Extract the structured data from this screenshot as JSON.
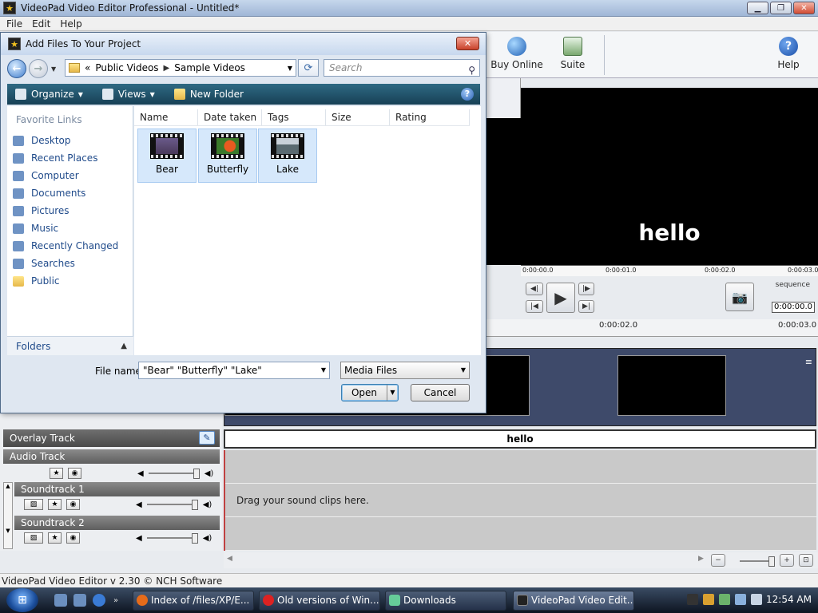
{
  "app": {
    "title": "VideoPad Video Editor Professional - Untitled*",
    "menu": [
      "File",
      "Edit",
      "Help"
    ],
    "toolbar": {
      "buy_online": "Buy Online",
      "suite": "Suite",
      "help": "Help"
    },
    "preview": {
      "text": "hello",
      "ruler": [
        "0:00:00.0",
        "0:00:01.0",
        "0:00:02.0",
        "0:00:03.0"
      ],
      "sequence_label": "sequence",
      "time": "0:00:00.0"
    },
    "timeline": {
      "ruler": [
        "0:00:02.0",
        "0:00:03.0"
      ],
      "overlay_text": "hello",
      "drag_hint": "Drag your sound clips here."
    },
    "tracks": {
      "overlay": "Overlay Track",
      "audio": "Audio Track",
      "soundtrack1": "Soundtrack 1",
      "soundtrack2": "Soundtrack 2"
    },
    "status": "VideoPad Video Editor v 2.30 © NCH Software"
  },
  "dialog": {
    "title": "Add Files To Your Project",
    "address": {
      "chevron": "«",
      "crumbs": [
        "Public Videos",
        "Sample Videos"
      ]
    },
    "search_placeholder": "Search",
    "commands": {
      "organize": "Organize",
      "views": "Views",
      "new_folder": "New Folder"
    },
    "favorites_header": "Favorite Links",
    "favorites": [
      "Desktop",
      "Recent Places",
      "Computer",
      "Documents",
      "Pictures",
      "Music",
      "Recently Changed",
      "Searches",
      "Public"
    ],
    "folders_label": "Folders",
    "columns": [
      "Name",
      "Date taken",
      "Tags",
      "Size",
      "Rating"
    ],
    "files": [
      "Bear",
      "Butterfly",
      "Lake"
    ],
    "file_name_label": "File name:",
    "file_name_value": "\"Bear\" \"Butterfly\" \"Lake\"",
    "file_type": "Media Files",
    "open_label": "Open",
    "cancel_label": "Cancel"
  },
  "taskbar": {
    "tasks": [
      "Index of /files/XP/E...",
      "Old versions of Win...",
      "Downloads",
      "VideoPad Video Edit..."
    ],
    "clock": "12:54 AM"
  }
}
